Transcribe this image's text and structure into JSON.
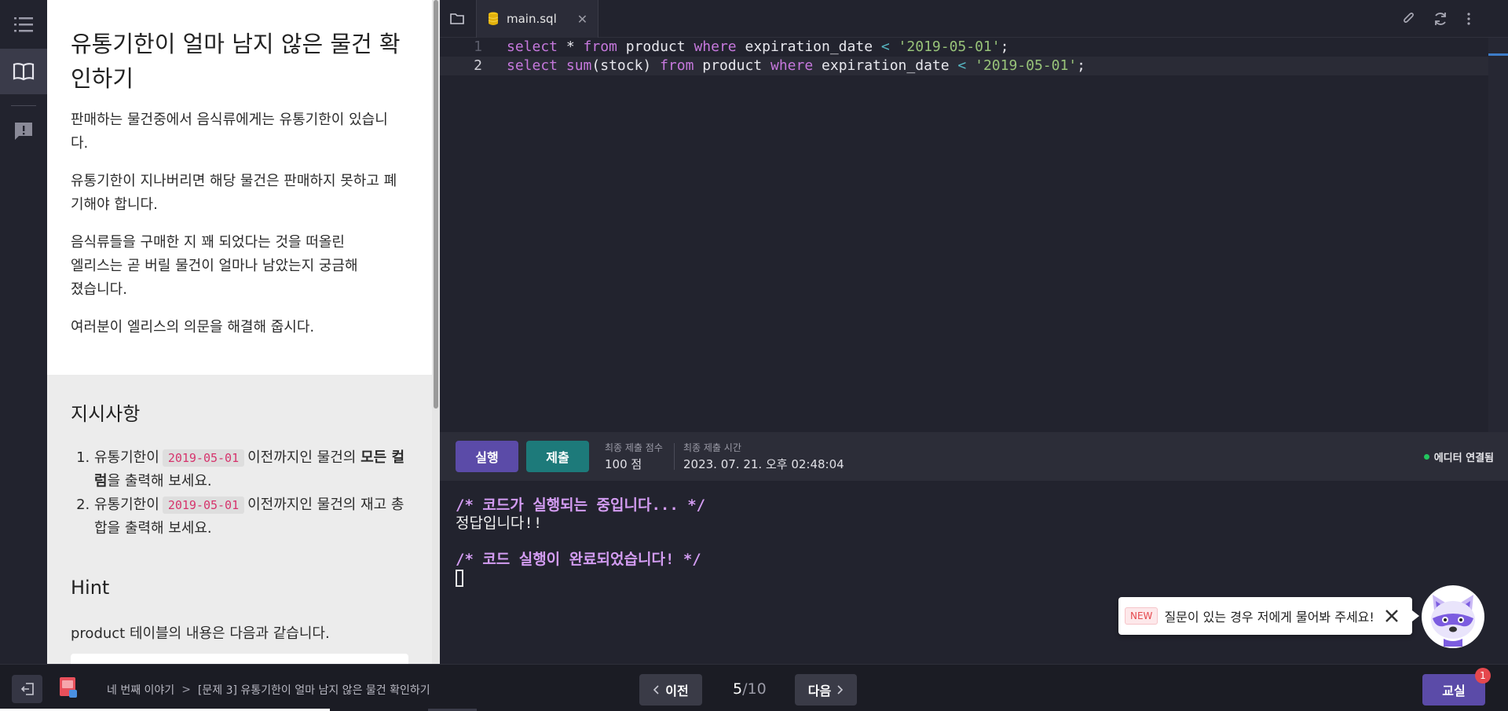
{
  "problem": {
    "title": "유통기한이 얼마 남지 않은 물건 확인하기",
    "paragraphs": [
      "판매하는 물건중에서 음식류에게는 유통기한이 있습니다.",
      "유통기한이 지나버리면 해당 물건은 판매하지 못하고 폐기해야 합니다.",
      "음식류들을 구매한 지 꽤 되었다는 것을 떠올린 엘리스는 곧 버릴 물건이 얼마나 남았는지 궁금해졌습니다.",
      "여러분이 엘리스의 의문을 해결해 줍시다."
    ],
    "instructions_title": "지시사항",
    "instructions": [
      {
        "pre": "유통기한이",
        "code": "2019-05-01",
        "mid": "이전까지인 물건의",
        "bold": "모든 컬럼",
        "post": "을 출력해 보세요."
      },
      {
        "pre": "유통기한이",
        "code": "2019-05-01",
        "mid": "이전까지인 물건의 재고 총합을 출력해 보세요.",
        "bold": "",
        "post": ""
      }
    ],
    "hint_title": "Hint",
    "hint_text": "product 테이블의 내용은 다음과 같습니다."
  },
  "editor": {
    "tab_name": "main.sql",
    "tab_close": "✕",
    "lines": [
      {
        "num": "1"
      },
      {
        "num": "2"
      }
    ],
    "code_tokens": {
      "select": "select",
      "star": " * ",
      "from": "from",
      "product": " product ",
      "where": "where",
      "col": " expiration_date ",
      "lt": "<",
      "date": " '2019-05-01'",
      "semi": ";",
      "sum": "sum",
      "stock": "(stock) "
    }
  },
  "actionbar": {
    "run_label": "실행",
    "submit_label": "제출",
    "score_label": "최종 제출 점수",
    "score_value": "100 점",
    "time_label": "최종 제출 시간",
    "time_value": "2023. 07. 21. 오후 02:48:04",
    "connection_label": "에디터 연결됨"
  },
  "console": {
    "running": "/* 코드가 실행되는 중입니다... */",
    "output": "정답입니다!!",
    "done": "/* 코드 실행이 완료되었습니다! */"
  },
  "chat": {
    "badge": "NEW",
    "text": "질문이 있는 경우 저에게 물어봐 주세요!"
  },
  "bottombar": {
    "breadcrumb_1": "네 번째 이야기",
    "breadcrumb_sep": ">",
    "breadcrumb_2": "[문제 3] 유통기한이 얼마 남지 않은 물건 확인하기",
    "prev_label": "이전",
    "next_label": "다음",
    "page_current": "5",
    "page_total": "/10",
    "class_label": "교실",
    "class_badge": "1"
  },
  "colors": {
    "accent": "#5b4ba8",
    "submit": "#1d7a7a",
    "connected": "#22c55e",
    "badge": "#e5484d"
  },
  "icons": [
    "menu-icon",
    "book-icon",
    "feedback-icon",
    "folder-icon",
    "database-icon",
    "attach-icon",
    "refresh-icon",
    "more-icon",
    "exit-icon",
    "chevron-left-icon",
    "chevron-right-icon",
    "close-icon"
  ]
}
